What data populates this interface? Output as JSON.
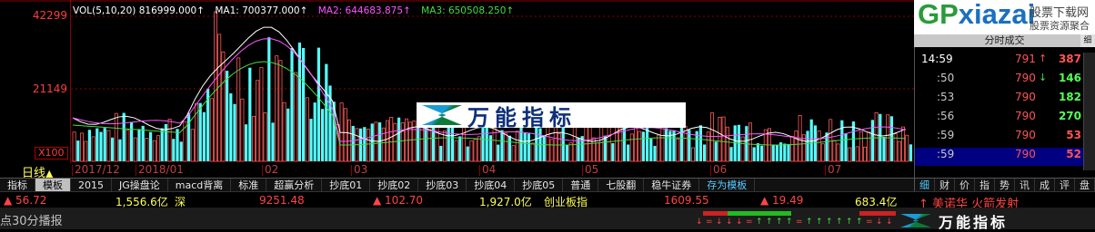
{
  "chart": {
    "y_labels": [
      "42299",
      "21149"
    ],
    "scale_label": "X100",
    "period_label": "日线",
    "ma_legend": {
      "vol": "VOL(5,10,20) 816999.000↑",
      "ma1": "MA1: 700377.000↑",
      "ma2": "MA2: 644683.875↑",
      "ma3": "MA3: 650508.250↑"
    },
    "x_labels": [
      "2017/12",
      "2018/01",
      "02",
      "03",
      "04",
      "05",
      "06",
      "07"
    ],
    "colors": {
      "up": "#ff5a5a",
      "down": "#55ffff",
      "ma1": "#ffffff",
      "ma2": "#ff55ff",
      "ma3": "#44dd44"
    }
  },
  "watermark": {
    "text": "万能指标"
  },
  "tabs": [
    "指标",
    "模板",
    "2015",
    "JG操盘论",
    "macd背离",
    "标准",
    "超赢分析",
    "抄底01",
    "抄底02",
    "抄底03",
    "抄底04",
    "抄底05",
    "普通",
    "七股翻",
    "稳牛证券",
    "存为模板"
  ],
  "right_panel": {
    "site": {
      "brand_g": "GP",
      "brand_x": "xiazai",
      "sub1": "股票下载网",
      "sub2": "股票资源聚合"
    },
    "header": "分时成交",
    "rows": [
      {
        "time": "14:59",
        "price": "791",
        "arrow": "↑",
        "vol": "387"
      },
      {
        "time": ":50",
        "price": "790",
        "arrow": "↓",
        "vol": "146"
      },
      {
        "time": ":53",
        "price": "790",
        "arrow": "",
        "vol": "182"
      },
      {
        "time": ":56",
        "price": "790",
        "arrow": "",
        "vol": "270"
      },
      {
        "time": ":59",
        "price": "790",
        "arrow": "",
        "vol": "53"
      },
      {
        "time": ":59",
        "price": "790",
        "arrow": "",
        "vol": "52"
      }
    ],
    "bottom_tabs": [
      "细",
      "财",
      "价",
      "指",
      "势",
      "讯",
      "成",
      "评",
      "盘"
    ]
  },
  "index_bar": {
    "i1_change": "▲ 56.72",
    "i1_amount": "1,556.6亿",
    "i1_name": "深",
    "i2_value": "9251.48",
    "i2_change": "▲ 102.70",
    "i2_amount": "1,927.0亿",
    "i2_name": "创业板指",
    "i3_value": "1609.55",
    "i3_change": "▲ 19.49",
    "i3_amount": "683.4亿",
    "news": "↑ 美诺华  火箭发射"
  },
  "status": {
    "scroll_text": "点30分播报",
    "brand": "万能指标"
  }
}
